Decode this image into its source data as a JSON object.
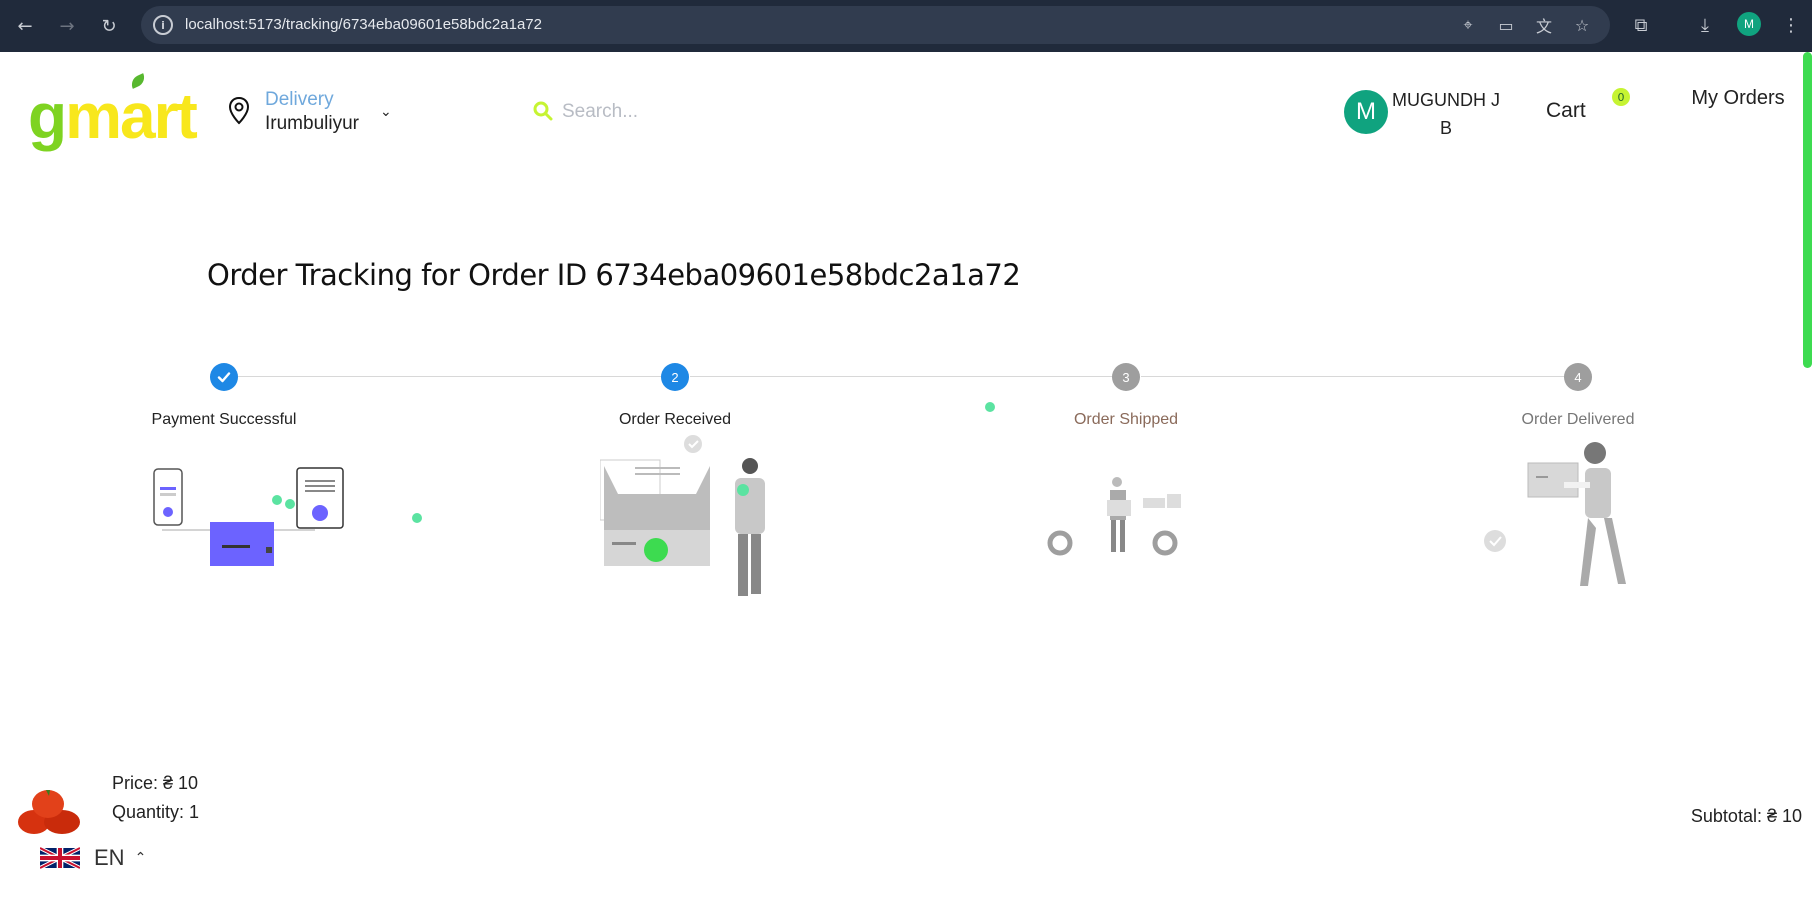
{
  "browser": {
    "url": "localhost:5173/tracking/6734eba09601e58bdc2a1a72",
    "profile_initial": "M"
  },
  "header": {
    "logo_g": "g",
    "logo_mart": "mart",
    "delivery_label": "Delivery",
    "location": "Irumbuliyur",
    "search_placeholder": "Search...",
    "user_initial": "M",
    "user_name": "MUGUNDH J B",
    "cart_label": "Cart",
    "cart_count": "0",
    "my_orders": "My Orders"
  },
  "page": {
    "title": "Order Tracking for Order ID 6734eba09601e58bdc2a1a72"
  },
  "steps": [
    {
      "number": "✓",
      "label": "Payment Successful",
      "state": "completed"
    },
    {
      "number": "2",
      "label": "Order Received",
      "state": "active"
    },
    {
      "number": "3",
      "label": "Order Shipped",
      "state": "pending"
    },
    {
      "number": "4",
      "label": "Order Delivered",
      "state": "pending"
    }
  ],
  "colors": {
    "step_blue": "#1e88e5",
    "step_gray": "#9e9e9e",
    "accent_purple": "#6c63ff",
    "accent_green": "#3ddb50"
  },
  "order_item": {
    "price": "Price: ₴ 10",
    "quantity": "Quantity: 1",
    "subtotal": "Subtotal: ₴ 10"
  },
  "language": {
    "code": "EN"
  }
}
